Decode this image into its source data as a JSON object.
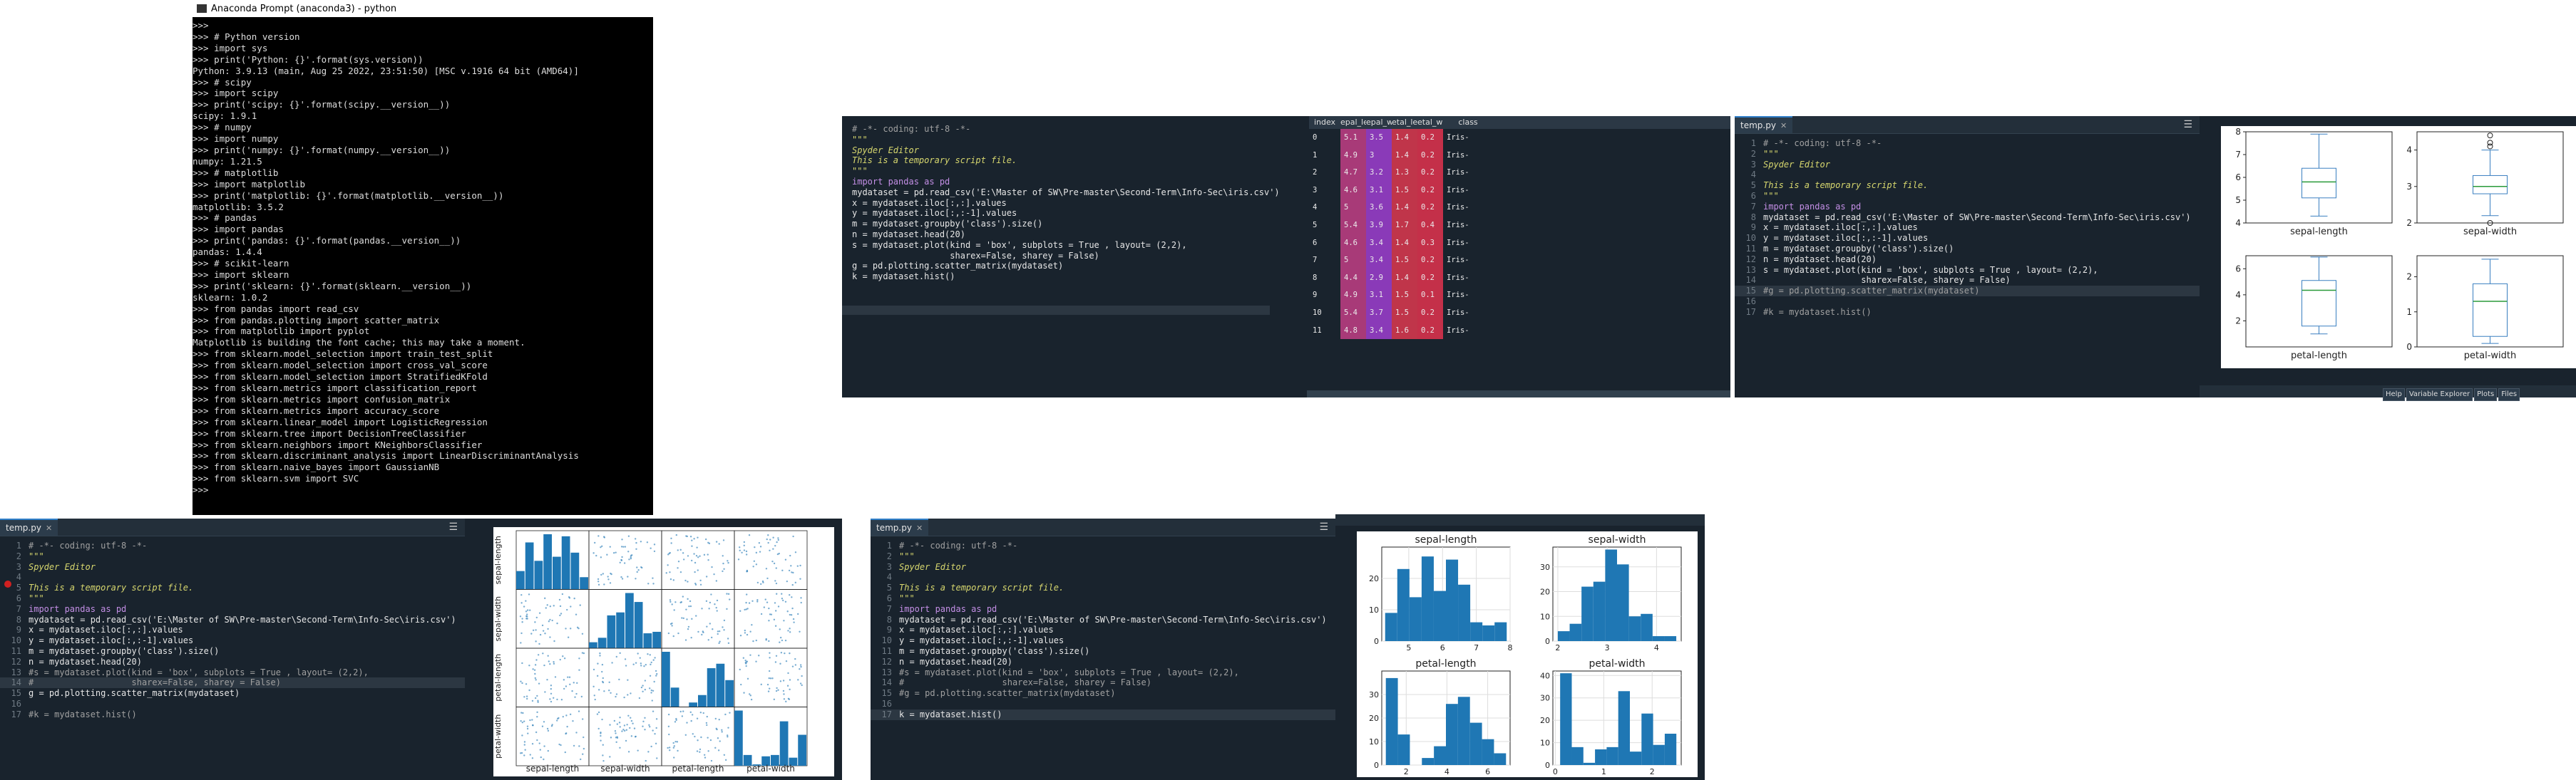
{
  "console": {
    "title": "Anaconda Prompt (anaconda3) - python",
    "lines": [
      ">>>",
      ">>> # Python version",
      ">>> import sys",
      ">>> print('Python: {}'.format(sys.version))",
      "Python: 3.9.13 (main, Aug 25 2022, 23:51:50) [MSC v.1916 64 bit (AMD64)]",
      ">>> # scipy",
      ">>> import scipy",
      ">>> print('scipy: {}'.format(scipy.__version__))",
      "scipy: 1.9.1",
      ">>> # numpy",
      ">>> import numpy",
      ">>> print('numpy: {}'.format(numpy.__version__))",
      "numpy: 1.21.5",
      ">>> # matplotlib",
      ">>> import matplotlib",
      ">>> print('matplotlib: {}'.format(matplotlib.__version__))",
      "matplotlib: 3.5.2",
      ">>> # pandas",
      ">>> import pandas",
      ">>> print('pandas: {}'.format(pandas.__version__))",
      "pandas: 1.4.4",
      ">>> # scikit-learn",
      ">>> import sklearn",
      ">>> print('sklearn: {}'.format(sklearn.__version__))",
      "sklearn: 1.0.2",
      ">>> from pandas import read_csv",
      ">>> from pandas.plotting import scatter_matrix",
      ">>> from matplotlib import pyplot",
      "Matplotlib is building the font cache; this may take a moment.",
      ">>> from sklearn.model_selection import train_test_split",
      ">>> from sklearn.model_selection import cross_val_score",
      ">>> from sklearn.model_selection import StratifiedKFold",
      ">>> from sklearn.metrics import classification_report",
      ">>> from sklearn.metrics import confusion_matrix",
      ">>> from sklearn.metrics import accuracy_score",
      ">>> from sklearn.linear_model import LogisticRegression",
      ">>> from sklearn.tree import DecisionTreeClassifier",
      ">>> from sklearn.neighbors import KNeighborsClassifier",
      ">>> from sklearn.discriminant_analysis import LinearDiscriminantAnalysis",
      ">>> from sklearn.naive_bayes import GaussianNB",
      ">>> from sklearn.svm import SVC",
      ">>>"
    ]
  },
  "editor_top": {
    "lines": [
      "# -*- coding: utf-8 -*-",
      "\"\"\"",
      "Spyder Editor",
      "",
      "This is a temporary script file.",
      "\"\"\"",
      "import pandas as pd",
      "mydataset = pd.read_csv('E:\\Master of SW\\Pre-master\\Second-Term\\Info-Sec\\iris.csv')",
      "x = mydataset.iloc[:,:].values",
      "y = mydataset.iloc[:,:-1].values",
      "m = mydataset.groupby('class').size()",
      "n = mydataset.head(20)",
      "s = mydataset.plot(kind = 'box', subplots = True , layout= (2,2),",
      "                   sharex=False, sharey = False)",
      "g = pd.plotting.scatter_matrix(mydataset)",
      "",
      "k = mydataset.hist()"
    ]
  },
  "dataframe": {
    "headers": [
      "index",
      "epal_lengt",
      "epal_widt",
      "etal_lengt",
      "etal_widt",
      "class"
    ],
    "rows": [
      [
        "0",
        "5.1",
        "3.5",
        "1.4",
        "0.2",
        "Iris-setosa"
      ],
      [
        "1",
        "4.9",
        "3",
        "1.4",
        "0.2",
        "Iris-setosa"
      ],
      [
        "2",
        "4.7",
        "3.2",
        "1.3",
        "0.2",
        "Iris-setosa"
      ],
      [
        "3",
        "4.6",
        "3.1",
        "1.5",
        "0.2",
        "Iris-setosa"
      ],
      [
        "4",
        "5",
        "3.6",
        "1.4",
        "0.2",
        "Iris-setosa"
      ],
      [
        "5",
        "5.4",
        "3.9",
        "1.7",
        "0.4",
        "Iris-setosa"
      ],
      [
        "6",
        "4.6",
        "3.4",
        "1.4",
        "0.3",
        "Iris-setosa"
      ],
      [
        "7",
        "5",
        "3.4",
        "1.5",
        "0.2",
        "Iris-setosa"
      ],
      [
        "8",
        "4.4",
        "2.9",
        "1.4",
        "0.2",
        "Iris-setosa"
      ],
      [
        "9",
        "4.9",
        "3.1",
        "1.5",
        "0.1",
        "Iris-setosa"
      ],
      [
        "10",
        "5.4",
        "3.7",
        "1.5",
        "0.2",
        "Iris-setosa"
      ],
      [
        "11",
        "4.8",
        "3.4",
        "1.6",
        "0.2",
        "Iris-setosa"
      ]
    ],
    "colors": {
      "c1": "#a83a78",
      "c2": "#8a3ab8",
      "c3": "#c0354a",
      "c4": "#c43049"
    }
  },
  "editor_right": {
    "tab": "temp.py",
    "lines": [
      "# -*- coding: utf-8 -*-",
      "\"\"\"",
      "Spyder Editor",
      "",
      "This is a temporary script file.",
      "\"\"\"",
      "import pandas as pd",
      "mydataset = pd.read_csv('E:\\Master of SW\\Pre-master\\Second-Term\\Info-Sec\\iris.csv')",
      "x = mydataset.iloc[:,:].values",
      "y = mydataset.iloc[:,:-1].values",
      "m = mydataset.groupby('class').size()",
      "n = mydataset.head(20)",
      "s = mydataset.plot(kind = 'box', subplots = True , layout= (2,2),",
      "                   sharex=False, sharey = False)",
      "#g = pd.plotting.scatter_matrix(mydataset)",
      "",
      "#k = mydataset.hist()"
    ]
  },
  "plots_pane": {
    "buttons": [
      "Help",
      "Variable Explorer",
      "Plots",
      "Files"
    ]
  },
  "editor_bl": {
    "tab": "temp.py",
    "lines": [
      "# -*- coding: utf-8 -*-",
      "\"\"\"",
      "Spyder Editor",
      "",
      "This is a temporary script file.",
      "\"\"\"",
      "import pandas as pd",
      "mydataset = pd.read_csv('E:\\Master of SW\\Pre-master\\Second-Term\\Info-Sec\\iris.csv')",
      "x = mydataset.iloc[:,:].values",
      "y = mydataset.iloc[:,:-1].values",
      "m = mydataset.groupby('class').size()",
      "n = mydataset.head(20)",
      "#s = mydataset.plot(kind = 'box', subplots = True , layout= (2,2),",
      "#                   sharex=False, sharey = False)",
      "g = pd.plotting.scatter_matrix(mydataset)",
      "",
      "#k = mydataset.hist()"
    ]
  },
  "editor_bm": {
    "tab": "temp.py",
    "lines": [
      "# -*- coding: utf-8 -*-",
      "\"\"\"",
      "Spyder Editor",
      "",
      "This is a temporary script file.",
      "\"\"\"",
      "import pandas as pd",
      "mydataset = pd.read_csv('E:\\Master of SW\\Pre-master\\Second-Term\\Info-Sec\\iris.csv')",
      "x = mydataset.iloc[:,:].values",
      "y = mydataset.iloc[:,:-1].values",
      "m = mydataset.groupby('class').size()",
      "n = mydataset.head(20)",
      "#s = mydataset.plot(kind = 'box', subplots = True , layout= (2,2),",
      "#                   sharex=False, sharey = False)",
      "#g = pd.plotting.scatter_matrix(mydataset)",
      "",
      "k = mydataset.hist()"
    ]
  },
  "chart_data": [
    {
      "type": "box",
      "panels": [
        {
          "name": "sepal-length",
          "ylim": [
            4,
            8
          ],
          "ticks": [
            4,
            5,
            6,
            7,
            8
          ],
          "min": 4.3,
          "q1": 5.1,
          "median": 5.8,
          "q3": 6.4,
          "max": 7.9,
          "outliers": []
        },
        {
          "name": "sepal-width",
          "ylim": [
            2,
            4.5
          ],
          "ticks": [
            2,
            3,
            4
          ],
          "min": 2.2,
          "q1": 2.8,
          "median": 3.0,
          "q3": 3.3,
          "max": 4.0,
          "outliers": [
            4.1,
            4.2,
            4.4,
            2.0
          ]
        },
        {
          "name": "petal-length",
          "ylim": [
            0,
            7
          ],
          "ticks": [
            2,
            4,
            6
          ],
          "min": 1.0,
          "q1": 1.6,
          "median": 4.35,
          "q3": 5.1,
          "max": 6.9,
          "outliers": []
        },
        {
          "name": "petal-width",
          "ylim": [
            0,
            2.6
          ],
          "ticks": [
            0,
            1,
            2
          ],
          "min": 0.1,
          "q1": 0.3,
          "median": 1.3,
          "q3": 1.8,
          "max": 2.5,
          "outliers": []
        }
      ]
    },
    {
      "type": "scatter",
      "variables": [
        "sepal-length",
        "sepal-width",
        "petal-length",
        "petal-width"
      ],
      "labels": [
        "sepal-length",
        "sepal-width",
        "petal-length",
        "petal-width"
      ],
      "ticks": {
        "sepal-length": [
          "5",
          "6",
          "7",
          "8"
        ],
        "sepal-width": [
          "2",
          "3",
          "4"
        ],
        "petal-length": [
          "2.5",
          "5.0"
        ],
        "petal-width": [
          "0",
          "2"
        ]
      },
      "ylabel_ticks": [
        "8",
        "6",
        "4",
        "3",
        "2",
        "5",
        "0",
        "2",
        "0"
      ]
    },
    {
      "type": "bar",
      "panels": [
        {
          "name": "sepal-length",
          "xlim": [
            4.2,
            8.0
          ],
          "xticks": [
            5,
            6,
            7,
            8
          ],
          "ylim": [
            0,
            30
          ],
          "yticks": [
            0,
            10,
            20
          ],
          "bin_start": 4.3,
          "bin_width": 0.36,
          "values": [
            9,
            23,
            14,
            27,
            16,
            26,
            18,
            6,
            5,
            6
          ]
        },
        {
          "name": "sepal-width",
          "xlim": [
            1.9,
            4.5
          ],
          "xticks": [
            2,
            3,
            4
          ],
          "ylim": [
            0,
            38
          ],
          "yticks": [
            0,
            10,
            20,
            30
          ],
          "bin_start": 2.0,
          "bin_width": 0.24,
          "values": [
            4,
            7,
            22,
            24,
            37,
            31,
            10,
            11,
            2,
            2
          ]
        },
        {
          "name": "petal-length",
          "xlim": [
            0.8,
            7.1
          ],
          "xticks": [
            2,
            4,
            6
          ],
          "ylim": [
            0,
            40
          ],
          "yticks": [
            0,
            10,
            20,
            30
          ],
          "bin_start": 1.0,
          "bin_width": 0.59,
          "values": [
            37,
            13,
            0,
            3,
            8,
            26,
            29,
            18,
            11,
            5
          ]
        },
        {
          "name": "petal-width",
          "xlim": [
            -0.05,
            2.6
          ],
          "xticks": [
            0,
            1,
            2
          ],
          "ylim": [
            0,
            42
          ],
          "yticks": [
            0,
            10,
            20,
            30,
            40
          ],
          "bin_start": 0.1,
          "bin_width": 0.24,
          "values": [
            41,
            8,
            1,
            7,
            8,
            33,
            6,
            23,
            9,
            14
          ]
        }
      ]
    }
  ]
}
